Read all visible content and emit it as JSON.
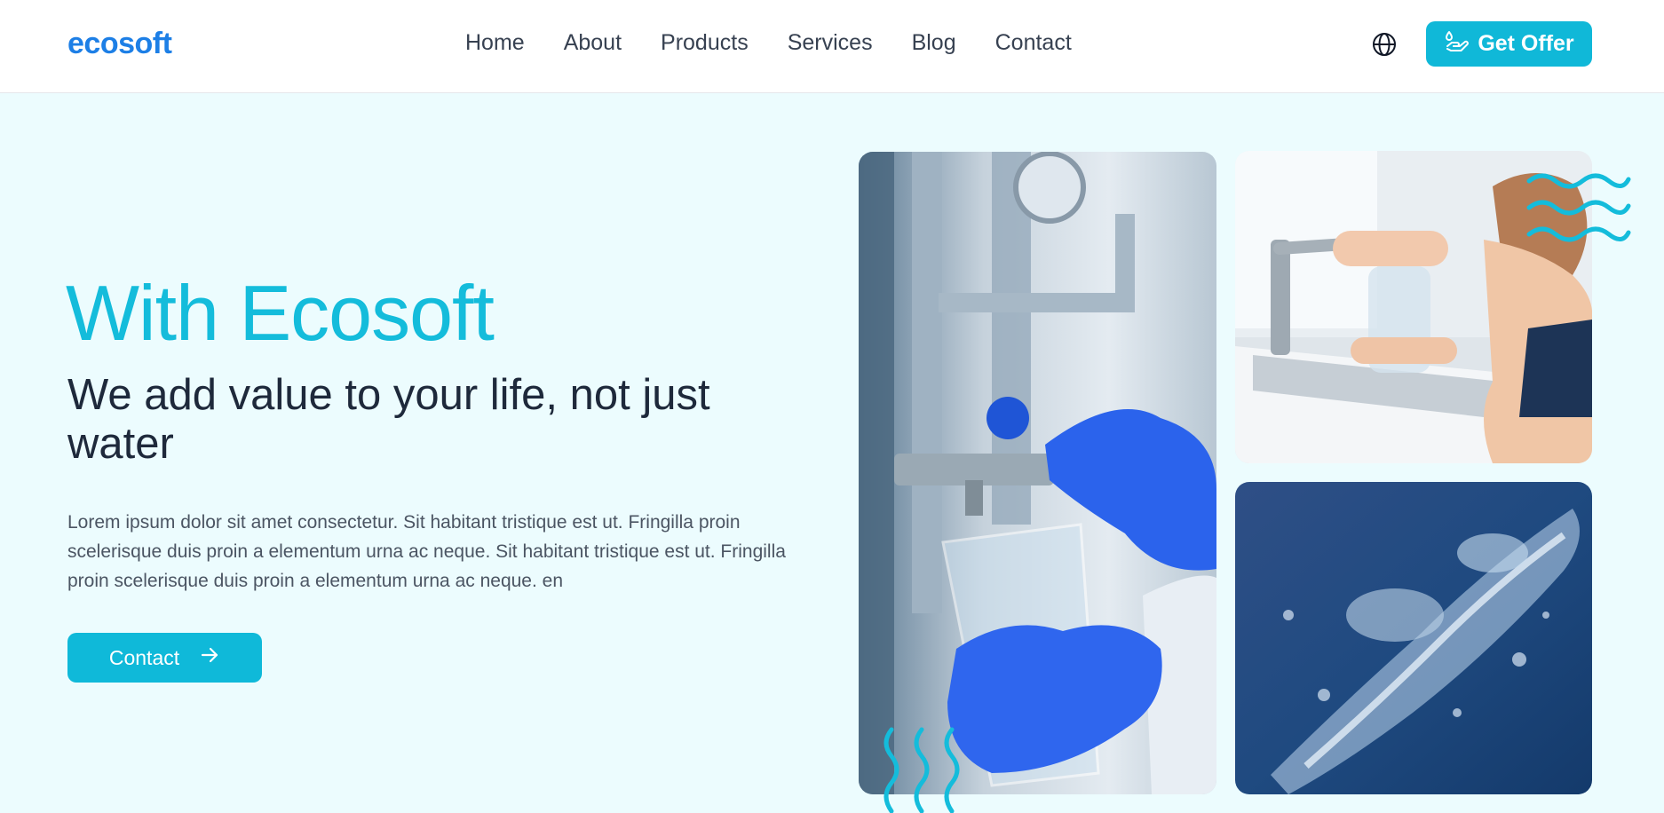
{
  "brand": {
    "logo": "ecosoft"
  },
  "nav": {
    "items": [
      "Home",
      "About",
      "Products",
      "Services",
      "Blog",
      "Contact"
    ]
  },
  "header": {
    "language_icon": "globe-icon",
    "offer_icon": "hand-drop-icon",
    "offer_label": "Get Offer"
  },
  "hero": {
    "title": "With Ecosoft",
    "subtitle": "We add value to your life, not just water",
    "description": "Lorem ipsum dolor sit amet consectetur. Sit habitant tristique est ut. Fringilla proin scelerisque duis proin a elementum urna ac neque. Sit habitant tristique est ut. Fringilla proin scelerisque duis proin a elementum urna ac neque. en",
    "cta_label": "Contact",
    "cta_icon": "arrow-right-icon"
  },
  "colors": {
    "accent": "#10b8d8",
    "logo": "#1d7fe6",
    "background": "#ecfcfe",
    "heading": "#1e293b"
  }
}
